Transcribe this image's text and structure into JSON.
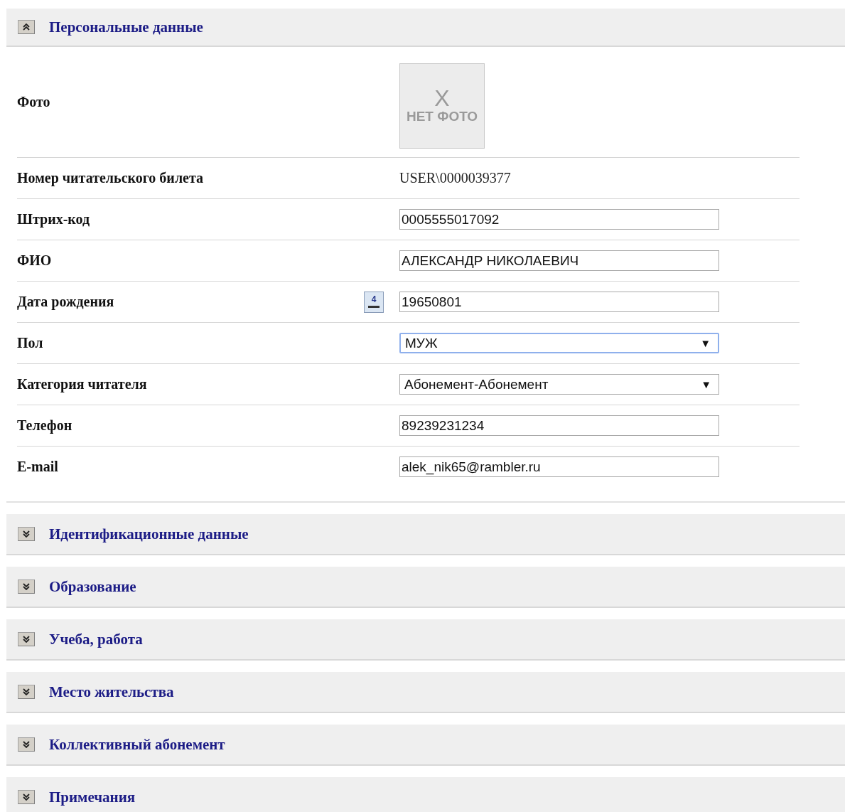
{
  "sections": [
    {
      "title": "Персональные данные",
      "expanded": true,
      "fields": [
        {
          "kind": "photo",
          "label": "Фото",
          "mark": "X",
          "caption": "НЕТ ФОТО"
        },
        {
          "kind": "text",
          "label": "Номер читательского билета",
          "value": "USER\\0000039377"
        },
        {
          "kind": "input",
          "label": "Штрих-код",
          "value": "0005555017092"
        },
        {
          "kind": "input",
          "label": "ФИО",
          "value": "АЛЕКСАНДР НИКОЛАЕВИЧ"
        },
        {
          "kind": "date",
          "label": "Дата рождения",
          "value": "19650801",
          "icon_digit": "4"
        },
        {
          "kind": "select",
          "label": "Пол",
          "value": "МУЖ",
          "focused": true,
          "arrow": "▼"
        },
        {
          "kind": "select",
          "label": "Категория читателя",
          "value": "Абонемент-Абонемент",
          "focused": false,
          "arrow": "▼"
        },
        {
          "kind": "input",
          "label": "Телефон",
          "value": "89239231234"
        },
        {
          "kind": "input",
          "label": "E-mail",
          "value": "alek_nik65@rambler.ru"
        }
      ]
    },
    {
      "title": "Идентификационные данные",
      "expanded": false
    },
    {
      "title": "Образование",
      "expanded": false
    },
    {
      "title": "Учеба, работа",
      "expanded": false
    },
    {
      "title": "Место жительства",
      "expanded": false
    },
    {
      "title": "Коллективный абонемент",
      "expanded": false
    },
    {
      "title": "Примечания",
      "expanded": false
    }
  ]
}
